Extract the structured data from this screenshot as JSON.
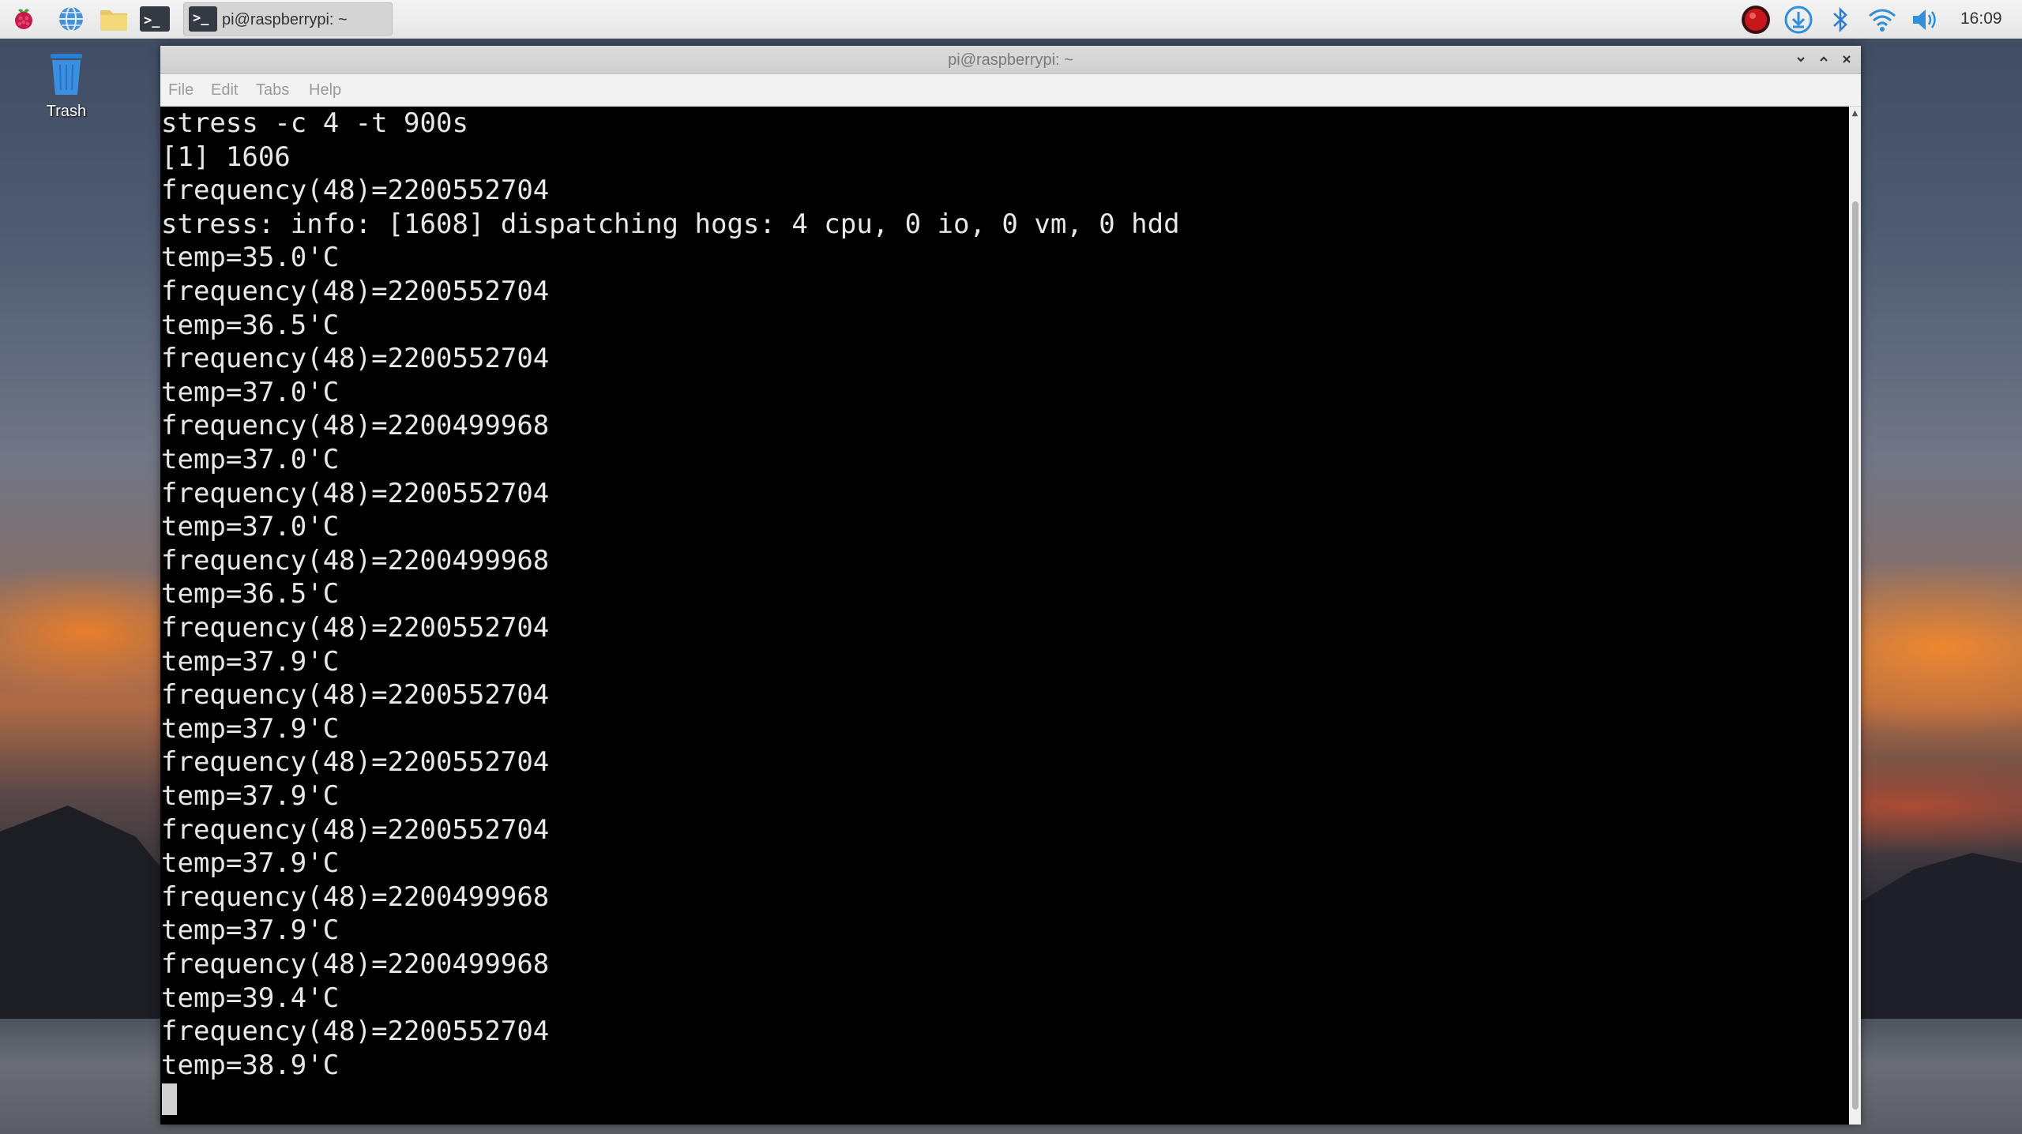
{
  "taskbar": {
    "launchers": [
      {
        "icon": "raspberry-menu-icon"
      },
      {
        "icon": "web-browser-icon"
      },
      {
        "icon": "file-manager-icon"
      },
      {
        "icon": "terminal-icon"
      }
    ],
    "task_button_label": "pi@raspberrypi: ~",
    "tray": {
      "icons": [
        "record-icon",
        "update-icon",
        "bluetooth-icon",
        "wifi-icon",
        "volume-icon"
      ],
      "clock": "16:09"
    }
  },
  "desktop": {
    "trash_label": "Trash"
  },
  "window": {
    "title": "pi@raspberrypi: ~",
    "controls": [
      "minimize",
      "maximize",
      "close"
    ],
    "menu": {
      "file": "File",
      "edit": "Edit",
      "tabs": "Tabs",
      "help": "Help"
    }
  },
  "terminal": {
    "lines": [
      "stress -c 4 -t 900s",
      "[1] 1606",
      "frequency(48)=2200552704",
      "stress: info: [1608] dispatching hogs: 4 cpu, 0 io, 0 vm, 0 hdd",
      "temp=35.0'C",
      "frequency(48)=2200552704",
      "temp=36.5'C",
      "frequency(48)=2200552704",
      "temp=37.0'C",
      "frequency(48)=2200499968",
      "temp=37.0'C",
      "frequency(48)=2200552704",
      "temp=37.0'C",
      "frequency(48)=2200499968",
      "temp=36.5'C",
      "frequency(48)=2200552704",
      "temp=37.9'C",
      "frequency(48)=2200552704",
      "temp=37.9'C",
      "frequency(48)=2200552704",
      "temp=37.9'C",
      "frequency(48)=2200552704",
      "temp=37.9'C",
      "frequency(48)=2200499968",
      "temp=37.9'C",
      "frequency(48)=2200499968",
      "temp=39.4'C",
      "frequency(48)=2200552704",
      "temp=38.9'C"
    ]
  }
}
